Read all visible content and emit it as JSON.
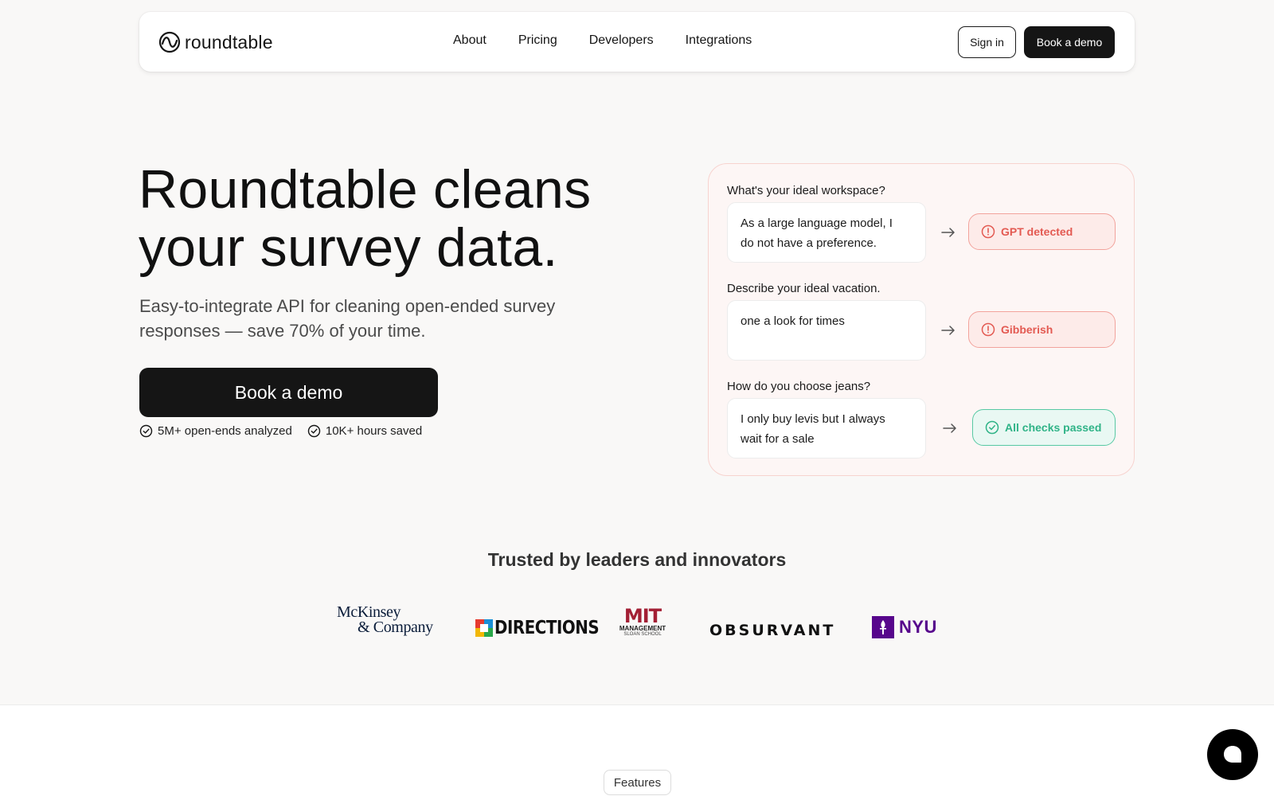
{
  "brand": {
    "name": "roundtable",
    "icon": "roundtable-logo-icon"
  },
  "nav": {
    "links": [
      "About",
      "Pricing",
      "Developers",
      "Integrations"
    ],
    "sign_in": "Sign in",
    "book_demo": "Book a demo"
  },
  "hero": {
    "title_line1": "Roundtable cleans",
    "title_line2": "your survey data.",
    "subtitle_line1": "Easy-to-integrate API for cleaning open-ended survey",
    "subtitle_line2": "responses — save 70% of your time.",
    "cta": "Book a demo",
    "stats": [
      "5M+ open-ends analyzed",
      "10K+ hours saved"
    ]
  },
  "demo": {
    "items": [
      {
        "question": "What's your ideal workspace?",
        "answer_line1": "As a large language model, I",
        "answer_line2": "do not have a preference.",
        "result": "GPT detected",
        "status": "flagged"
      },
      {
        "question": "Describe your ideal vacation.",
        "answer_line1": "one a look for times",
        "answer_line2": "",
        "result": "Gibberish",
        "status": "flagged"
      },
      {
        "question": "How do you choose jeans?",
        "answer_line1": "I only buy levis but I always",
        "answer_line2": "wait for a sale",
        "result": "All checks passed",
        "status": "passed"
      }
    ]
  },
  "trusted": {
    "title": "Trusted by leaders and innovators",
    "logos": {
      "mckinsey_line1": "McKinsey",
      "mckinsey_line2": "& Company",
      "directions": "DIRECTIONS",
      "mit_main": "MIT",
      "mit_line2": "MANAGEMENT",
      "mit_line3": "SLOAN SCHOOL",
      "observant": "OBSURVANT",
      "nyu": "NYU"
    }
  },
  "features_label": "Features",
  "colors": {
    "dark": "#151515",
    "flag_red": "#e35a52",
    "pass_green": "#2fb387",
    "card_bg": "#fdf6f5",
    "nyu_purple": "#57068c"
  }
}
